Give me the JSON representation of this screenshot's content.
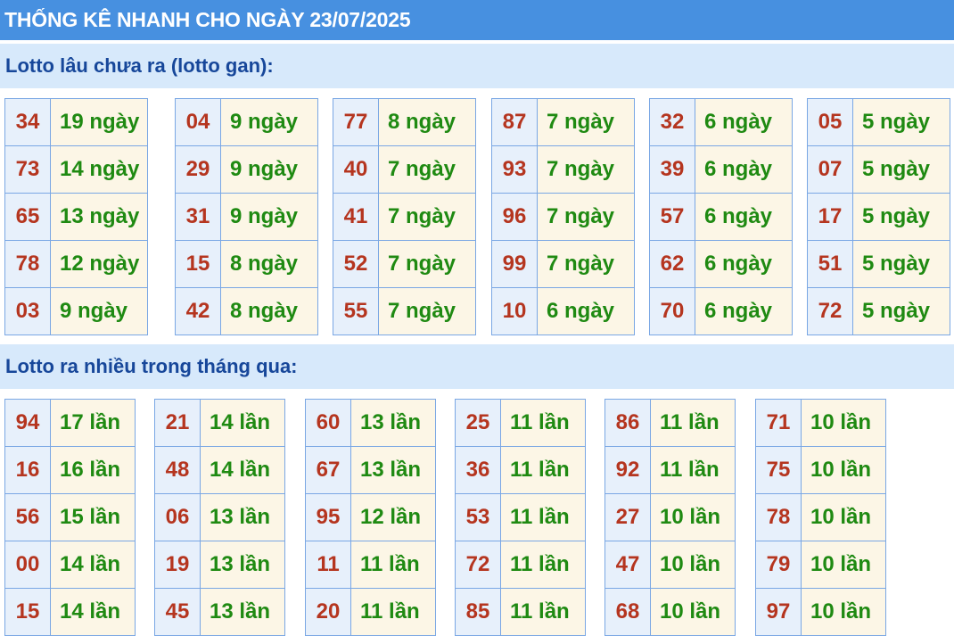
{
  "header": {
    "title": "THỐNG KÊ NHANH CHO NGÀY 23/07/2025"
  },
  "sections": {
    "gan": {
      "title": "Lotto lâu chưa ra (lotto gan):",
      "columns": [
        [
          [
            "34",
            "19 ngày"
          ],
          [
            "73",
            "14 ngày"
          ],
          [
            "65",
            "13 ngày"
          ],
          [
            "78",
            "12 ngày"
          ],
          [
            "03",
            "9 ngày"
          ]
        ],
        [
          [
            "04",
            "9 ngày"
          ],
          [
            "29",
            "9 ngày"
          ],
          [
            "31",
            "9 ngày"
          ],
          [
            "15",
            "8 ngày"
          ],
          [
            "42",
            "8 ngày"
          ]
        ],
        [
          [
            "77",
            "8 ngày"
          ],
          [
            "40",
            "7 ngày"
          ],
          [
            "41",
            "7 ngày"
          ],
          [
            "52",
            "7 ngày"
          ],
          [
            "55",
            "7 ngày"
          ]
        ],
        [
          [
            "87",
            "7 ngày"
          ],
          [
            "93",
            "7 ngày"
          ],
          [
            "96",
            "7 ngày"
          ],
          [
            "99",
            "7 ngày"
          ],
          [
            "10",
            "6 ngày"
          ]
        ],
        [
          [
            "32",
            "6 ngày"
          ],
          [
            "39",
            "6 ngày"
          ],
          [
            "57",
            "6 ngày"
          ],
          [
            "62",
            "6 ngày"
          ],
          [
            "70",
            "6 ngày"
          ]
        ],
        [
          [
            "05",
            "5 ngày"
          ],
          [
            "07",
            "5 ngày"
          ],
          [
            "17",
            "5 ngày"
          ],
          [
            "51",
            "5 ngày"
          ],
          [
            "72",
            "5 ngày"
          ]
        ]
      ]
    },
    "freq": {
      "title": "Lotto ra nhiều trong tháng qua:",
      "columns": [
        [
          [
            "94",
            "17 lần"
          ],
          [
            "16",
            "16 lần"
          ],
          [
            "56",
            "15 lần"
          ],
          [
            "00",
            "14 lần"
          ],
          [
            "15",
            "14 lần"
          ]
        ],
        [
          [
            "21",
            "14 lần"
          ],
          [
            "48",
            "14 lần"
          ],
          [
            "06",
            "13 lần"
          ],
          [
            "19",
            "13 lần"
          ],
          [
            "45",
            "13 lần"
          ]
        ],
        [
          [
            "60",
            "13 lần"
          ],
          [
            "67",
            "13 lần"
          ],
          [
            "95",
            "12 lần"
          ],
          [
            "11",
            "11 lần"
          ],
          [
            "20",
            "11 lần"
          ]
        ],
        [
          [
            "25",
            "11 lần"
          ],
          [
            "36",
            "11 lần"
          ],
          [
            "53",
            "11 lần"
          ],
          [
            "72",
            "11 lần"
          ],
          [
            "85",
            "11 lần"
          ]
        ],
        [
          [
            "86",
            "11 lần"
          ],
          [
            "92",
            "11 lần"
          ],
          [
            "27",
            "10 lần"
          ],
          [
            "47",
            "10 lần"
          ],
          [
            "68",
            "10 lần"
          ]
        ],
        [
          [
            "71",
            "10 lần"
          ],
          [
            "75",
            "10 lần"
          ],
          [
            "78",
            "10 lần"
          ],
          [
            "79",
            "10 lần"
          ],
          [
            "97",
            "10 lần"
          ]
        ]
      ]
    }
  },
  "colors": {
    "header_bg": "#4790e0",
    "subhead_bg": "#d7e9fb",
    "subhead_text": "#17479a",
    "number_text": "#b5351f",
    "count_text": "#1f8a12",
    "number_cell_bg": "#e7f0fb",
    "count_cell_bg": "#fcf6e6",
    "cell_border": "#7aa7e4"
  }
}
